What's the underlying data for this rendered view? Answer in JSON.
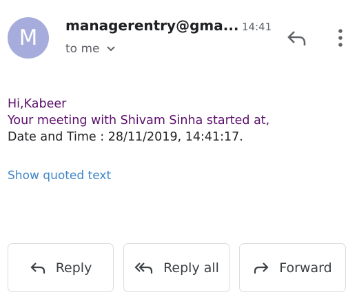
{
  "message": {
    "avatar_letter": "M",
    "avatar_color": "#a6acdb",
    "sender": "managerentry@gma...",
    "time": "14:41",
    "recipient": "to me",
    "body": {
      "greeting": "Hi,Kabeer",
      "line1": "Your meeting with Shivam Sinha started at,",
      "line2": "Date and Time : 28/11/2019, 14:41:17."
    },
    "show_quoted": "Show quoted text"
  },
  "actions": {
    "reply": "Reply",
    "reply_all": "Reply all",
    "forward": "Forward"
  },
  "icons": {
    "top_reply": "reply-icon",
    "top_more": "more-vert-icon",
    "expand": "chevron-down-icon",
    "reply": "reply-icon",
    "reply_all": "reply-all-icon",
    "forward": "forward-icon"
  }
}
